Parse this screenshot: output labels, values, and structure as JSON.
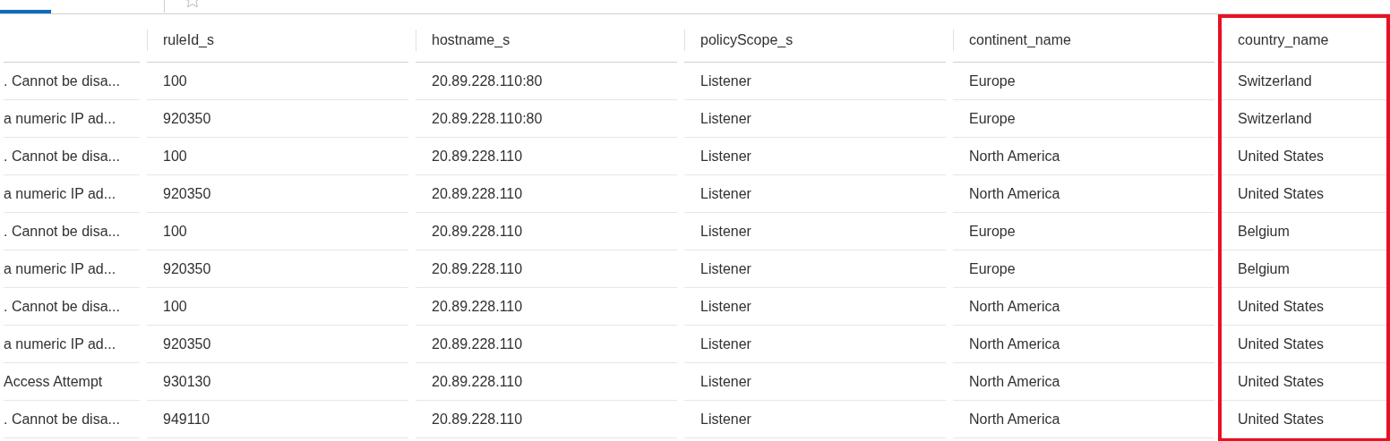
{
  "table": {
    "columns": [
      {
        "highlighted": false
      },
      {
        "label": "ruleId_s",
        "highlighted": false
      },
      {
        "label": "hostname_s",
        "highlighted": false
      },
      {
        "label": "policyScope_s",
        "highlighted": false
      },
      {
        "label": "continent_name",
        "highlighted": false
      },
      {
        "label": "country_name",
        "highlighted": true
      }
    ],
    "rows": [
      [
        ". Cannot be disa...",
        "100",
        "20.89.228.110:80",
        "Listener",
        "Europe",
        "Switzerland"
      ],
      [
        "a numeric IP ad...",
        "920350",
        "20.89.228.110:80",
        "Listener",
        "Europe",
        "Switzerland"
      ],
      [
        ". Cannot be disa...",
        "100",
        "20.89.228.110",
        "Listener",
        "North America",
        "United States"
      ],
      [
        "a numeric IP ad...",
        "920350",
        "20.89.228.110",
        "Listener",
        "North America",
        "United States"
      ],
      [
        ". Cannot be disa...",
        "100",
        "20.89.228.110",
        "Listener",
        "Europe",
        "Belgium"
      ],
      [
        "a numeric IP ad...",
        "920350",
        "20.89.228.110",
        "Listener",
        "Europe",
        "Belgium"
      ],
      [
        ". Cannot be disa...",
        "100",
        "20.89.228.110",
        "Listener",
        "North America",
        "United States"
      ],
      [
        "a numeric IP ad...",
        "920350",
        "20.89.228.110",
        "Listener",
        "North America",
        "United States"
      ],
      [
        "Access Attempt",
        "930130",
        "20.89.228.110",
        "Listener",
        "North America",
        "United States"
      ],
      [
        ". Cannot be disa...",
        "949110",
        "20.89.228.110",
        "Listener",
        "North America",
        "United States"
      ]
    ]
  }
}
